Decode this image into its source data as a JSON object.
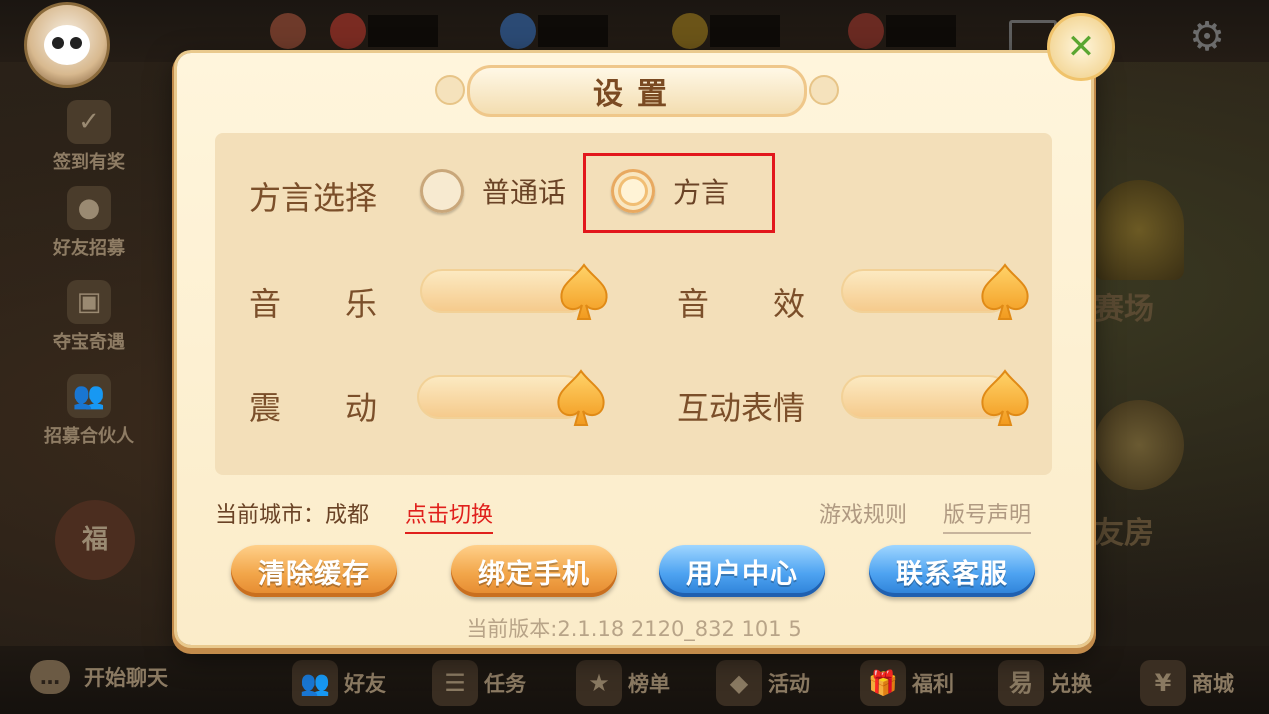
{
  "background": {
    "side_menu": [
      "签到有奖",
      "好友招募",
      "夺宝奇遇",
      "招募合伙人"
    ],
    "chat_label": "开始聊天",
    "bottom_nav": [
      "好友",
      "任务",
      "榜单",
      "活动",
      "福利",
      "兑换",
      "商城"
    ],
    "right_labels": [
      "赛场",
      "友房"
    ]
  },
  "settings": {
    "title": "设置",
    "close_icon": "leaf-close-icon",
    "dialect": {
      "label": "方言选择",
      "options": [
        "普通话",
        "方言"
      ],
      "selected": "方言"
    },
    "toggles": {
      "music": "音　　乐",
      "sound_effect": "音　　效",
      "vibration": "震　　动",
      "emote": "互动表情",
      "music_level": 1.0,
      "sound_effect_level": 1.0,
      "vibration_level": 1.0,
      "emote_level": 1.0
    },
    "city_label": "当前城市：成都",
    "switch_city": "点击切换",
    "game_rules": "游戏规则",
    "version_statement": "版号声明",
    "buttons": {
      "clear_cache": "清除缓存",
      "bind_phone": "绑定手机",
      "user_center": "用户中心",
      "contact_service": "联系客服"
    },
    "version": "当前版本:2.1.18 2120_832 101 5"
  },
  "colors": {
    "panel_bg": "#fbecc9",
    "accent_orange": "#f2a64a",
    "accent_blue": "#4ea3f1",
    "highlight_red": "#e2171c"
  }
}
